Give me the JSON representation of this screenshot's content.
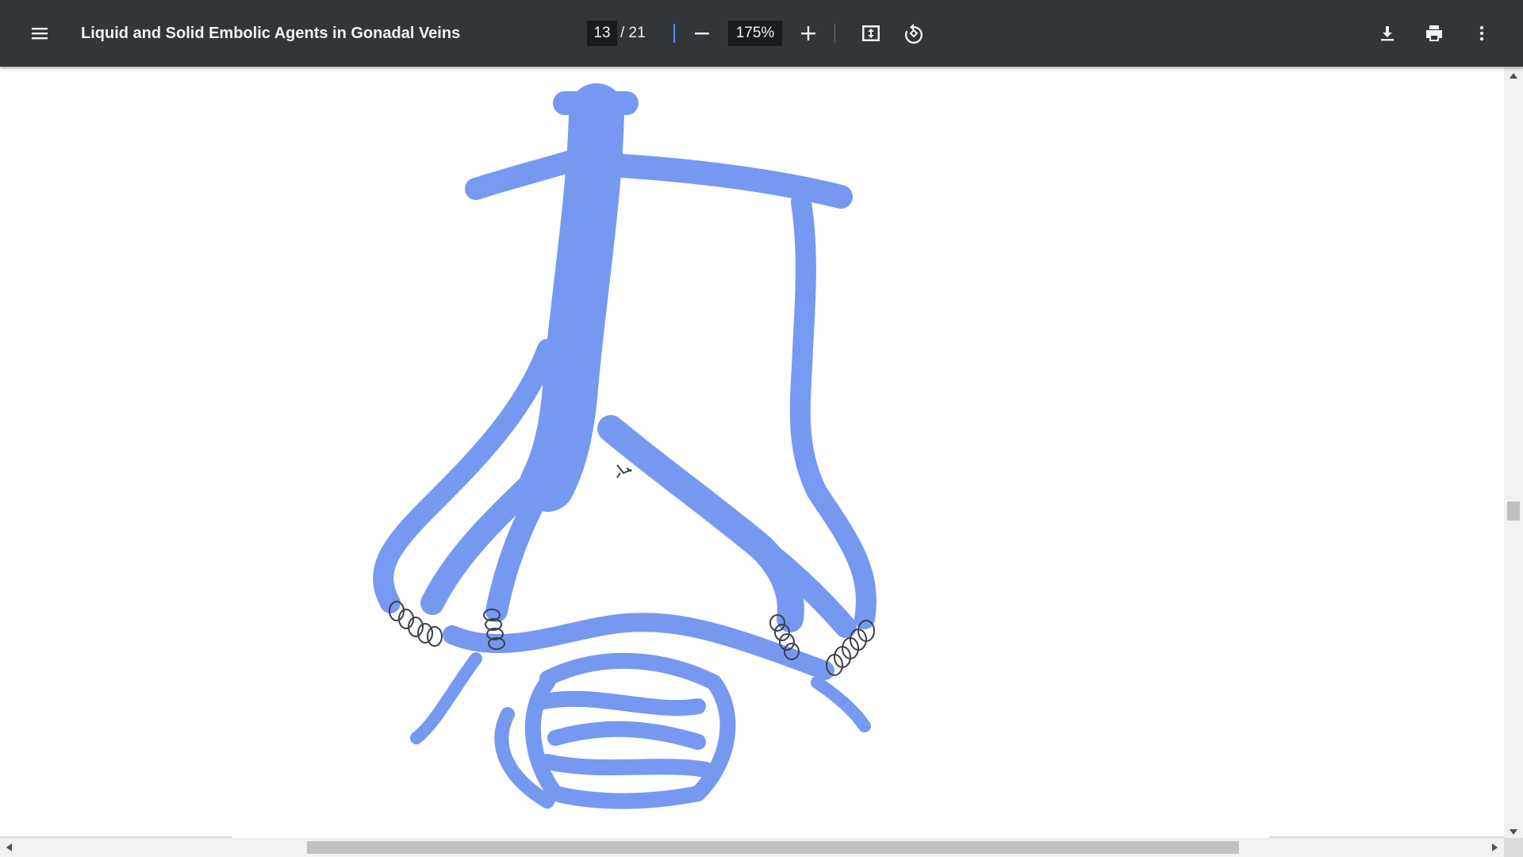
{
  "toolbar": {
    "menu_icon": "hamburger-menu-icon",
    "title": "Liquid and Solid Embolic Agents in Gonadal Veins",
    "current_page": "13",
    "page_total": "/ 21",
    "zoom": "175%",
    "icons": {
      "zoom_out": "minus-icon",
      "zoom_in": "plus-icon",
      "fit": "fit-to-page-icon",
      "rotate": "rotate-counterclockwise-icon",
      "download": "download-icon",
      "print": "print-icon",
      "more": "more-vertical-icon"
    }
  },
  "colors": {
    "toolbar_bg": "#323639",
    "vein_blue": "#6f93f0",
    "coil": "#3a3f4a"
  }
}
